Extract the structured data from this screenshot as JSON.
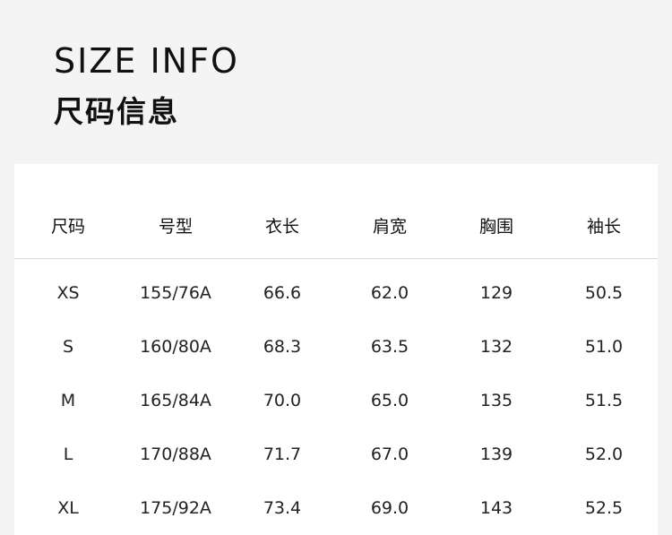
{
  "title_en": "SIZE INFO",
  "title_cn": "尺码信息",
  "table": {
    "headers": [
      "尺码",
      "号型",
      "衣长",
      "肩宽",
      "胸围",
      "袖长"
    ],
    "rows": [
      [
        "XS",
        "155/76A",
        "66.6",
        "62.0",
        "129",
        "50.5"
      ],
      [
        "S",
        "160/80A",
        "68.3",
        "63.5",
        "132",
        "51.0"
      ],
      [
        "M",
        "165/84A",
        "70.0",
        "65.0",
        "135",
        "51.5"
      ],
      [
        "L",
        "170/88A",
        "71.7",
        "67.0",
        "139",
        "52.0"
      ],
      [
        "XL",
        "175/92A",
        "73.4",
        "69.0",
        "143",
        "52.5"
      ]
    ]
  }
}
